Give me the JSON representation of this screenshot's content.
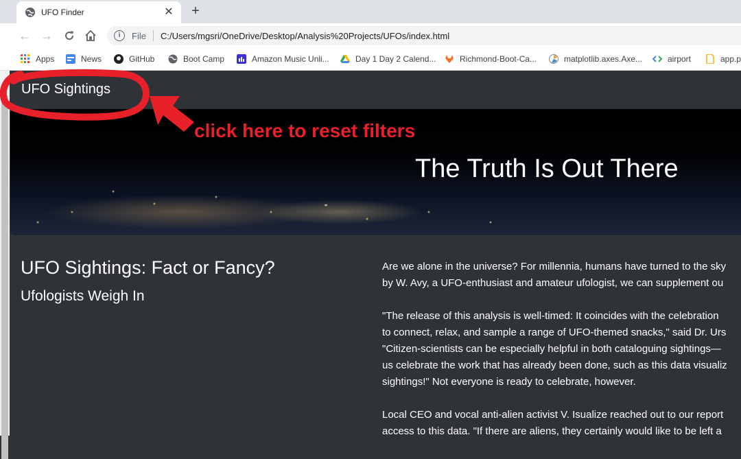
{
  "browser": {
    "tab": {
      "title": "UFO Finder"
    },
    "address": {
      "label": "File",
      "url": "C:/Users/mgsri/OneDrive/Desktop/Analysis%20Projects/UFOs/index.html"
    },
    "bookmarks": [
      {
        "label": "Apps",
        "icon": "apps-grid-icon",
        "color": "#e94235"
      },
      {
        "label": "News",
        "icon": "news-icon",
        "color": "#4285f4"
      },
      {
        "label": "GitHub",
        "icon": "github-icon",
        "color": "#202124"
      },
      {
        "label": "Boot Camp",
        "icon": "globe-icon",
        "color": "#5f6368"
      },
      {
        "label": "Amazon Music Unli...",
        "icon": "amazon-music-icon",
        "color": "#3d2fe0"
      },
      {
        "label": "Day 1 Day 2 Calend...",
        "icon": "google-drive-icon",
        "color": "#fbbc04"
      },
      {
        "label": "Richmond-Boot-Ca...",
        "icon": "gitlab-icon",
        "color": "#fc6d26"
      },
      {
        "label": "matplotlib.axes.Axe...",
        "icon": "matplotlib-icon",
        "color": "#8a8a8a"
      },
      {
        "label": "airport",
        "icon": "code-icon",
        "color": "#34a853"
      },
      {
        "label": "app.p",
        "icon": "document-icon",
        "color": "#f9ab00"
      }
    ]
  },
  "page": {
    "brand": "UFO Sightings",
    "hero_headline": "The Truth Is Out There",
    "article": {
      "title": "UFO Sightings: Fact or Fancy?",
      "subtitle": "Ufologists Weigh In",
      "paragraphs": [
        [
          "Are we alone in the universe? For millennia, humans have turned to the sky",
          "by W. Avy, a UFO-enthusiast and amateur ufologist, we can supplement ou"
        ],
        [
          "\"The release of this analysis is well-timed: It coincides with the celebration",
          "to connect, relax, and sample a range of UFO-themed snacks,\" said Dr. Urs",
          "\"Citizen-scientists can be especially helpful in both cataloguing sightings—",
          "us celebrate the work that has already been done, such as this data visualiz",
          "sightings!\" Not everyone is ready to celebrate, however."
        ],
        [
          "Local CEO and vocal anti-alien activist V. Isualize reached out to our report",
          "access to this data. \"If there are aliens, they certainly would like to be left a"
        ]
      ]
    }
  },
  "annotation": {
    "text": "click here to reset filters",
    "color": "#e8202a"
  }
}
